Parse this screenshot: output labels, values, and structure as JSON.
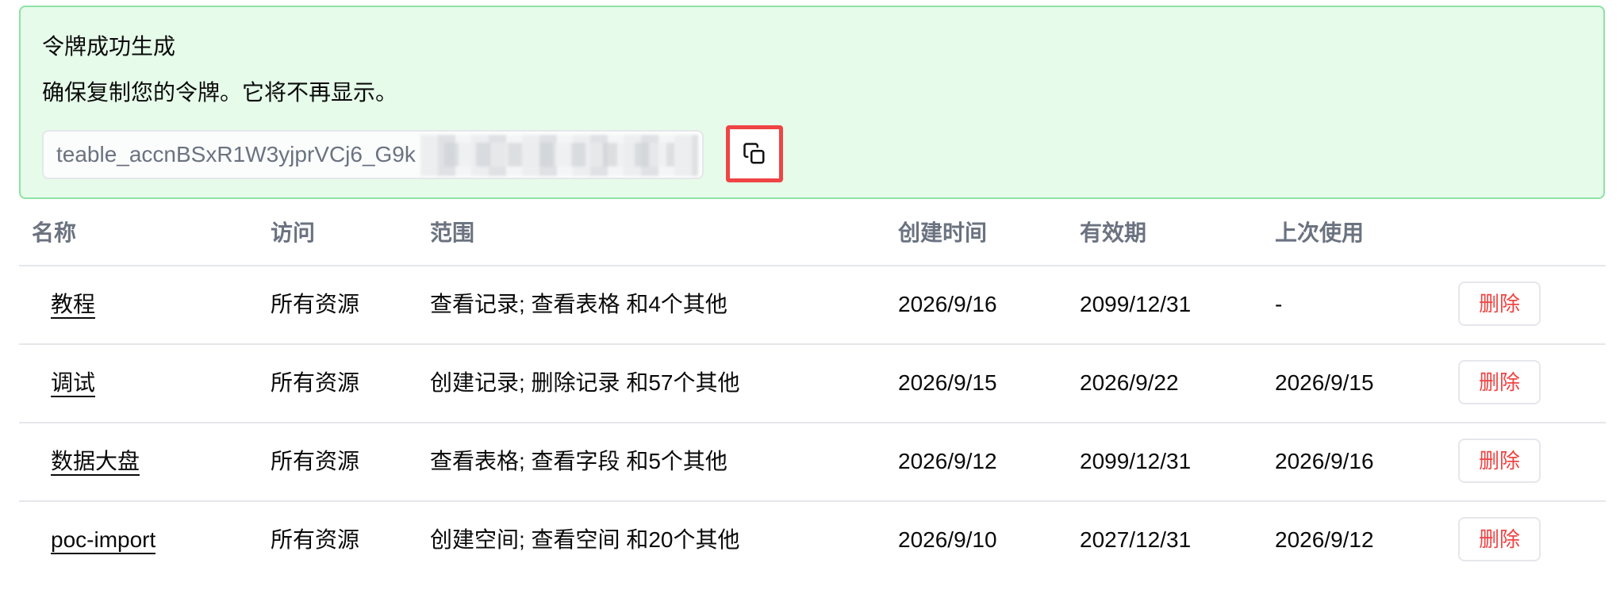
{
  "banner": {
    "title": "令牌成功生成",
    "description": "确保复制您的令牌。它将不再显示。",
    "token_visible": "teable_accnBSxR1W3yjprVCj6_G9k",
    "copy_icon": "copy-icon",
    "accent_color": "#ef4444",
    "background_color": "#e6fbe9"
  },
  "table": {
    "headers": {
      "name": "名称",
      "access": "访问",
      "scope": "范围",
      "created": "创建时间",
      "expires": "有效期",
      "last_used": "上次使用"
    },
    "rows": [
      {
        "name": "教程",
        "access": "所有资源",
        "scope": "查看记录; 查看表格 和4个其他",
        "created": "2026/9/16",
        "expires": "2099/12/31",
        "last_used": "-",
        "action": "删除"
      },
      {
        "name": "调试",
        "access": "所有资源",
        "scope": "创建记录; 删除记录 和57个其他",
        "created": "2026/9/15",
        "expires": "2026/9/22",
        "last_used": "2026/9/15",
        "action": "删除"
      },
      {
        "name": "数据大盘",
        "access": "所有资源",
        "scope": "查看表格; 查看字段 和5个其他",
        "created": "2026/9/12",
        "expires": "2099/12/31",
        "last_used": "2026/9/16",
        "action": "删除"
      },
      {
        "name": "poc-import",
        "access": "所有资源",
        "scope": "创建空间; 查看空间 和20个其他",
        "created": "2026/9/10",
        "expires": "2027/12/31",
        "last_used": "2026/9/12",
        "action": "删除"
      }
    ]
  }
}
